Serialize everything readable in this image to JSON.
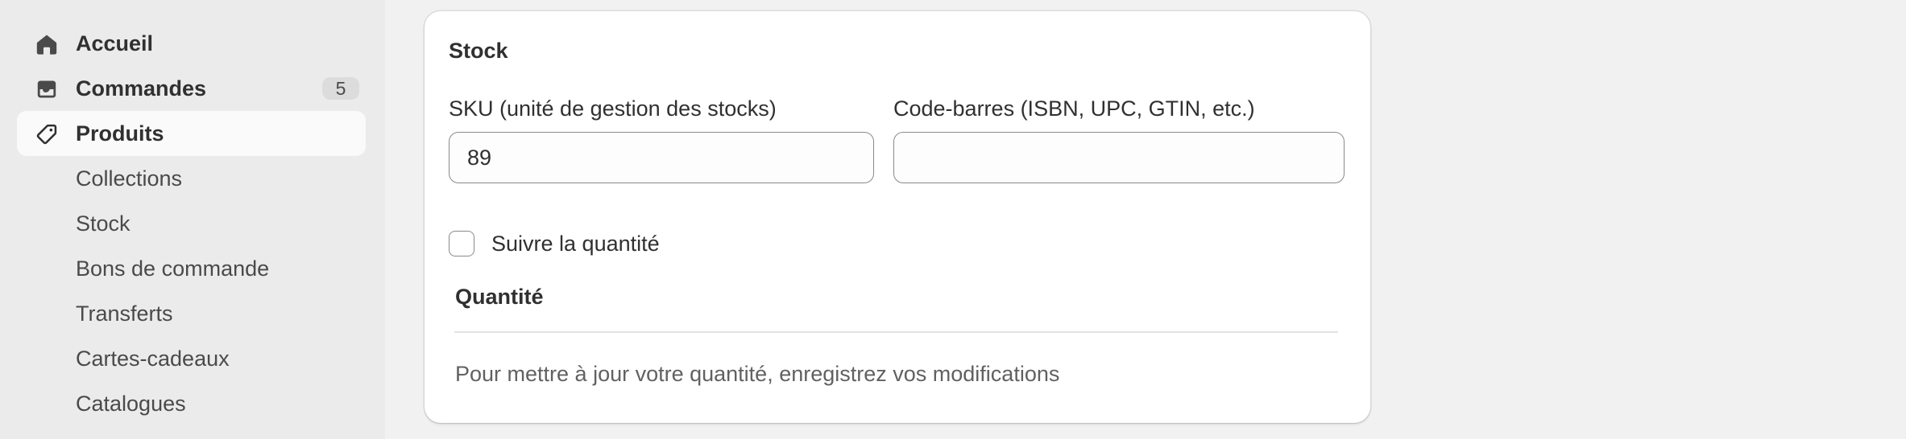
{
  "sidebar": {
    "items": [
      {
        "label": "Accueil",
        "icon": "home-icon"
      },
      {
        "label": "Commandes",
        "icon": "inbox-icon",
        "badge": "5"
      },
      {
        "label": "Produits",
        "icon": "tag-icon",
        "active": true
      }
    ],
    "subitems": [
      {
        "label": "Collections"
      },
      {
        "label": "Stock"
      },
      {
        "label": "Bons de commande"
      },
      {
        "label": "Transferts"
      },
      {
        "label": "Cartes-cadeaux"
      },
      {
        "label": "Catalogues"
      }
    ]
  },
  "card": {
    "title": "Stock",
    "sku": {
      "label": "SKU (unité de gestion des stocks)",
      "value": "89"
    },
    "barcode": {
      "label": "Code-barres (ISBN, UPC, GTIN, etc.)",
      "value": ""
    },
    "track_quantity": {
      "label": "Suivre la quantité",
      "checked": false
    },
    "quantity": {
      "title": "Quantité",
      "hint": "Pour mettre à jour votre quantité, enregistrez vos modifications"
    }
  }
}
